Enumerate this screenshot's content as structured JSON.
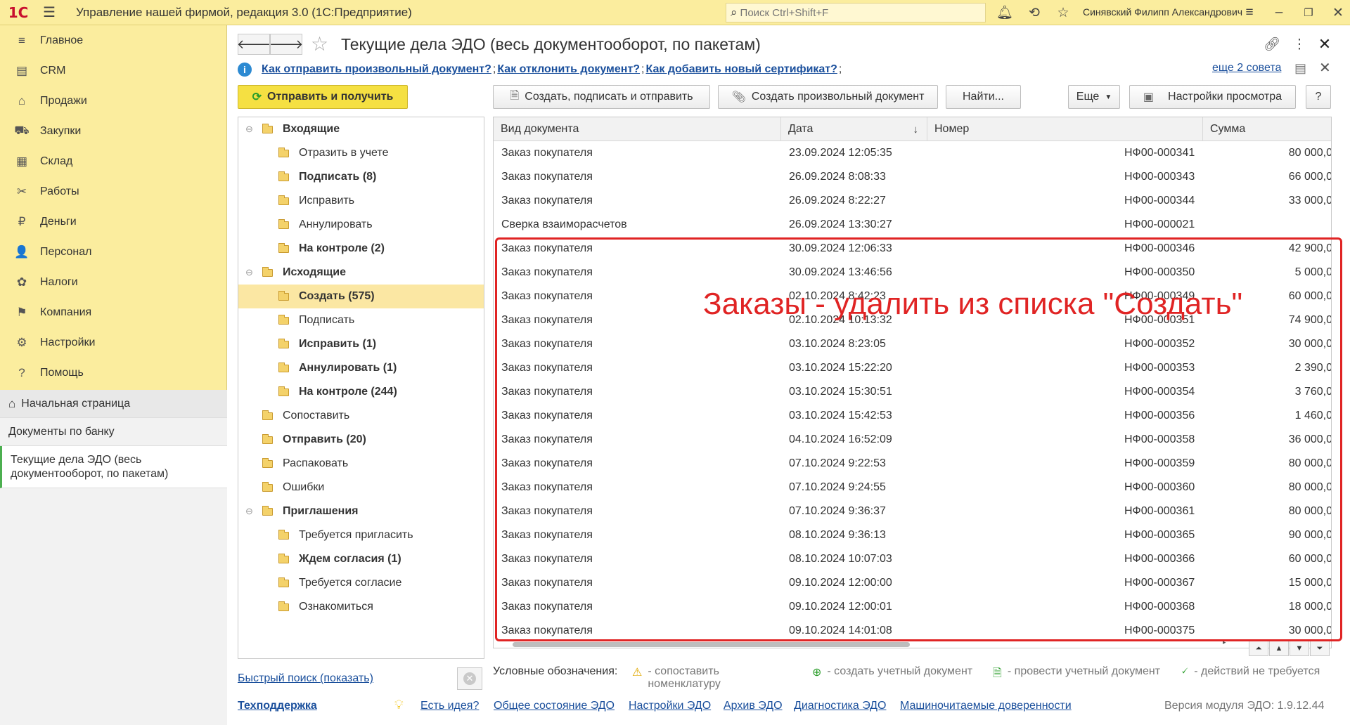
{
  "app": {
    "logo": "1С",
    "title": "Управление нашей фирмой, редакция 3.0  (1С:Предприятие)",
    "search_placeholder": "Поиск Ctrl+Shift+F",
    "user": "Синявский Филипп Александрович"
  },
  "sidebar": {
    "items": [
      {
        "label": "Главное",
        "icon": "≡"
      },
      {
        "label": "CRM",
        "icon": "▤"
      },
      {
        "label": "Продажи",
        "icon": "⌂"
      },
      {
        "label": "Закупки",
        "icon": "⛟"
      },
      {
        "label": "Склад",
        "icon": "▦"
      },
      {
        "label": "Работы",
        "icon": "✂"
      },
      {
        "label": "Деньги",
        "icon": "₽"
      },
      {
        "label": "Персонал",
        "icon": "👤"
      },
      {
        "label": "Налоги",
        "icon": "✿"
      },
      {
        "label": "Компания",
        "icon": "⚑"
      },
      {
        "label": "Настройки",
        "icon": "⚙"
      },
      {
        "label": "Помощь",
        "icon": "?"
      }
    ],
    "home": "Начальная страница",
    "open_bank": "Документы по банку",
    "open_current_line1": "Текущие дела ЭДО (весь",
    "open_current_line2": "документооборот, по пакетам)"
  },
  "page": {
    "title": "Текущие дела ЭДО (весь документооборот, по пакетам)"
  },
  "tips": {
    "tip1": "Как отправить произвольный документ?",
    "tip2": "Как отклонить документ?",
    "tip3": "Как добавить новый сертификат?",
    "sep": ";",
    "more": "еще 2 совета"
  },
  "toolbar": {
    "send_receive": "Отправить и получить",
    "create_sign_send": "Создать, подписать и отправить",
    "create_arbitrary": "Создать произвольный документ",
    "find": "Найти...",
    "more": "Еще",
    "view_settings": "Настройки просмотра",
    "help": "?"
  },
  "tree": [
    {
      "label": "Входящие",
      "level": 0,
      "bold": true,
      "toggle": "⊖"
    },
    {
      "label": "Отразить в учете",
      "level": 1,
      "bold": false
    },
    {
      "label": "Подписать (8)",
      "level": 1,
      "bold": true
    },
    {
      "label": "Исправить",
      "level": 1,
      "bold": false
    },
    {
      "label": "Аннулировать",
      "level": 1,
      "bold": false
    },
    {
      "label": "На контроле (2)",
      "level": 1,
      "bold": true
    },
    {
      "label": "Исходящие",
      "level": 0,
      "bold": true,
      "toggle": "⊖"
    },
    {
      "label": "Создать (575)",
      "level": 1,
      "bold": true,
      "selected": true
    },
    {
      "label": "Подписать",
      "level": 1,
      "bold": false
    },
    {
      "label": "Исправить (1)",
      "level": 1,
      "bold": true
    },
    {
      "label": "Аннулировать (1)",
      "level": 1,
      "bold": true
    },
    {
      "label": "На контроле (244)",
      "level": 1,
      "bold": true
    },
    {
      "label": "Сопоставить",
      "level": 0,
      "bold": false
    },
    {
      "label": "Отправить (20)",
      "level": 0,
      "bold": true
    },
    {
      "label": "Распаковать",
      "level": 0,
      "bold": false
    },
    {
      "label": "Ошибки",
      "level": 0,
      "bold": false
    },
    {
      "label": "Приглашения",
      "level": 0,
      "bold": true,
      "toggle": "⊖"
    },
    {
      "label": "Требуется пригласить",
      "level": 1,
      "bold": false
    },
    {
      "label": "Ждем согласия (1)",
      "level": 1,
      "bold": true
    },
    {
      "label": "Требуется согласие",
      "level": 1,
      "bold": false
    },
    {
      "label": "Ознакомиться",
      "level": 1,
      "bold": false
    }
  ],
  "table": {
    "columns": [
      "Вид документа",
      "Дата",
      "Номер",
      "Сумма"
    ],
    "sort_arrow": "↓",
    "rows": [
      {
        "kind": "Заказ покупателя",
        "date": "23.09.2024 12:05:35",
        "number": "НФ00-000341",
        "sum": "80 000,0"
      },
      {
        "kind": "Заказ покупателя",
        "date": "26.09.2024 8:08:33",
        "number": "НФ00-000343",
        "sum": "66 000,0"
      },
      {
        "kind": "Заказ покупателя",
        "date": "26.09.2024 8:22:27",
        "number": "НФ00-000344",
        "sum": "33 000,0"
      },
      {
        "kind": "Сверка взаиморасчетов",
        "date": "26.09.2024 13:30:27",
        "number": "НФ00-000021",
        "sum": ""
      },
      {
        "kind": "Заказ покупателя",
        "date": "30.09.2024 12:06:33",
        "number": "НФ00-000346",
        "sum": "42 900,0"
      },
      {
        "kind": "Заказ покупателя",
        "date": "30.09.2024 13:46:56",
        "number": "НФ00-000350",
        "sum": "5 000,0"
      },
      {
        "kind": "Заказ покупателя",
        "date": "02.10.2024 8:42:23",
        "number": "НФ00-000349",
        "sum": "60 000,0"
      },
      {
        "kind": "Заказ покупателя",
        "date": "02.10.2024 10:13:32",
        "number": "НФ00-000351",
        "sum": "74 900,0"
      },
      {
        "kind": "Заказ покупателя",
        "date": "03.10.2024 8:23:05",
        "number": "НФ00-000352",
        "sum": "30 000,0"
      },
      {
        "kind": "Заказ покупателя",
        "date": "03.10.2024 15:22:20",
        "number": "НФ00-000353",
        "sum": "2 390,0"
      },
      {
        "kind": "Заказ покупателя",
        "date": "03.10.2024 15:30:51",
        "number": "НФ00-000354",
        "sum": "3 760,0"
      },
      {
        "kind": "Заказ покупателя",
        "date": "03.10.2024 15:42:53",
        "number": "НФ00-000356",
        "sum": "1 460,0"
      },
      {
        "kind": "Заказ покупателя",
        "date": "04.10.2024 16:52:09",
        "number": "НФ00-000358",
        "sum": "36 000,0"
      },
      {
        "kind": "Заказ покупателя",
        "date": "07.10.2024 9:22:53",
        "number": "НФ00-000359",
        "sum": "80 000,0"
      },
      {
        "kind": "Заказ покупателя",
        "date": "07.10.2024 9:24:55",
        "number": "НФ00-000360",
        "sum": "80 000,0"
      },
      {
        "kind": "Заказ покупателя",
        "date": "07.10.2024 9:36:37",
        "number": "НФ00-000361",
        "sum": "80 000,0"
      },
      {
        "kind": "Заказ покупателя",
        "date": "08.10.2024 9:36:13",
        "number": "НФ00-000365",
        "sum": "90 000,0"
      },
      {
        "kind": "Заказ покупателя",
        "date": "08.10.2024 10:07:03",
        "number": "НФ00-000366",
        "sum": "60 000,0"
      },
      {
        "kind": "Заказ покупателя",
        "date": "09.10.2024 12:00:00",
        "number": "НФ00-000367",
        "sum": "15 000,0"
      },
      {
        "kind": "Заказ покупателя",
        "date": "09.10.2024 12:00:01",
        "number": "НФ00-000368",
        "sum": "18 000,0"
      },
      {
        "kind": "Заказ покупателя",
        "date": "09.10.2024 14:01:08",
        "number": "НФ00-000375",
        "sum": "30 000,0"
      }
    ]
  },
  "annotation": "Заказы - удалить из списка \"Создать\"",
  "bottom": {
    "quick_search": "Быстрый поиск (показать)",
    "legend_title": "Условные обозначения:",
    "legend_match_1": "- сопоставить",
    "legend_match_2": "номенклатуру",
    "legend_create": "- создать учетный документ",
    "legend_post": "- провести учетный документ",
    "legend_none": "- действий не требуется",
    "support": "Техподдержка",
    "idea": "Есть идея?",
    "edo_state": "Общее состояние ЭДО",
    "edo_settings": "Настройки ЭДО",
    "edo_archive": "Архив ЭДО",
    "edo_diag": "Диагностика ЭДО",
    "machine_poa": "Машиночитаемые доверенности",
    "version": "Версия модуля ЭДО: 1.9.12.44"
  }
}
